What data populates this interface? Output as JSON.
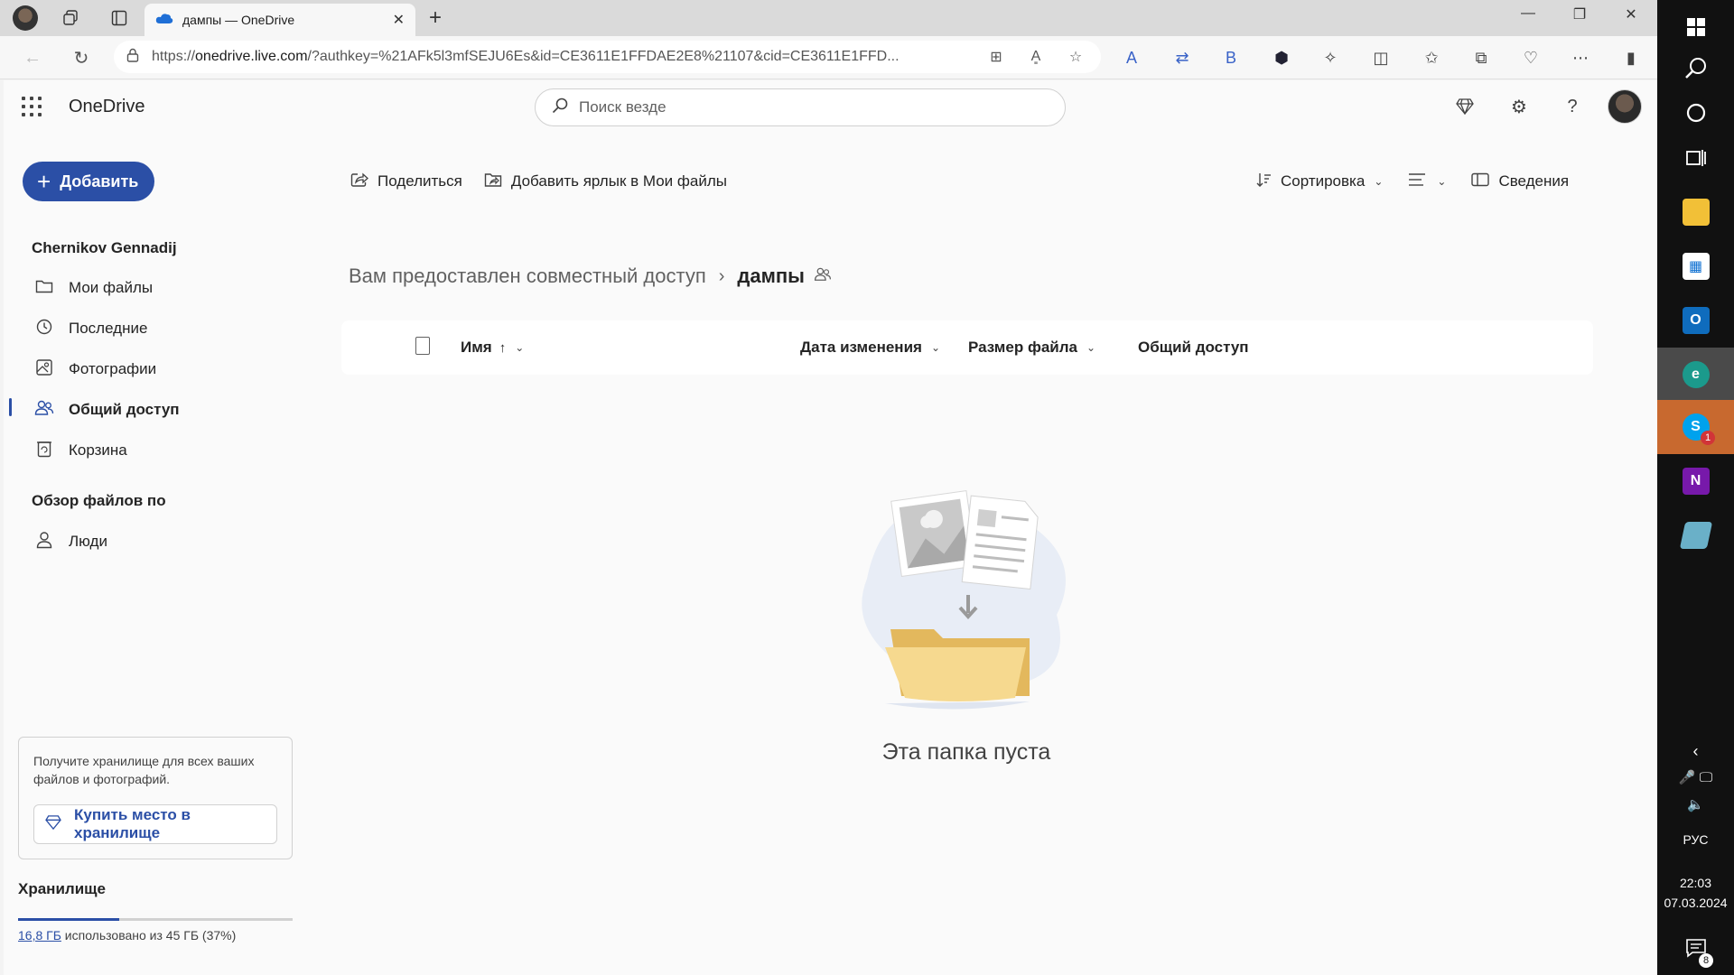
{
  "browser": {
    "tab_title": "дампы — OneDrive",
    "url_host": "onedrive.live.com",
    "url_prefix": "https://",
    "url_rest": "/?authkey=%21AFk5l3mfSEJU6Es&id=CE3611E1FFDAE2E8%21107&cid=CE3611E1FFD...",
    "new_tab_symbol": "+",
    "close_tab_symbol": "✕"
  },
  "header": {
    "app_title": "OneDrive",
    "search_placeholder": "Поиск везде"
  },
  "sidebar": {
    "add_label": "Добавить",
    "owner": "Chernikov Gennadij",
    "items": [
      {
        "label": "Мои файлы",
        "icon": "folder-icon"
      },
      {
        "label": "Последние",
        "icon": "recent-icon"
      },
      {
        "label": "Фотографии",
        "icon": "photos-icon"
      },
      {
        "label": "Общий доступ",
        "icon": "shared-icon"
      },
      {
        "label": "Корзина",
        "icon": "recycle-bin-icon"
      }
    ],
    "browse_by": "Обзор файлов по",
    "people_label": "Люди",
    "promo_text": "Получите хранилище для всех ваших файлов и фотографий.",
    "buy_label": "Купить место в хранилище",
    "storage_title": "Хранилище",
    "storage_used": "16,8 ГБ",
    "storage_rest": "использовано из 45 ГБ (37%)",
    "storage_fraction": 0.37
  },
  "commands": {
    "share": "Поделиться",
    "add_shortcut": "Добавить ярлык в Мои файлы",
    "sort": "Сортировка",
    "details": "Сведения"
  },
  "breadcrumb": {
    "parent": "Вам предоставлен совместный доступ",
    "current": "дампы"
  },
  "table": {
    "col_name": "Имя",
    "sort_arrow": "↑",
    "col_modified": "Дата изменения",
    "col_size": "Размер файла",
    "col_sharing": "Общий доступ"
  },
  "empty": {
    "text": "Эта папка пуста"
  },
  "taskbar": {
    "lang": "РУС",
    "time": "22:03",
    "date": "07.03.2024",
    "notifications": "8",
    "skype_badge": "1"
  },
  "colors": {
    "accent": "#2b4fa6",
    "skype_highlight": "#c8692f"
  }
}
